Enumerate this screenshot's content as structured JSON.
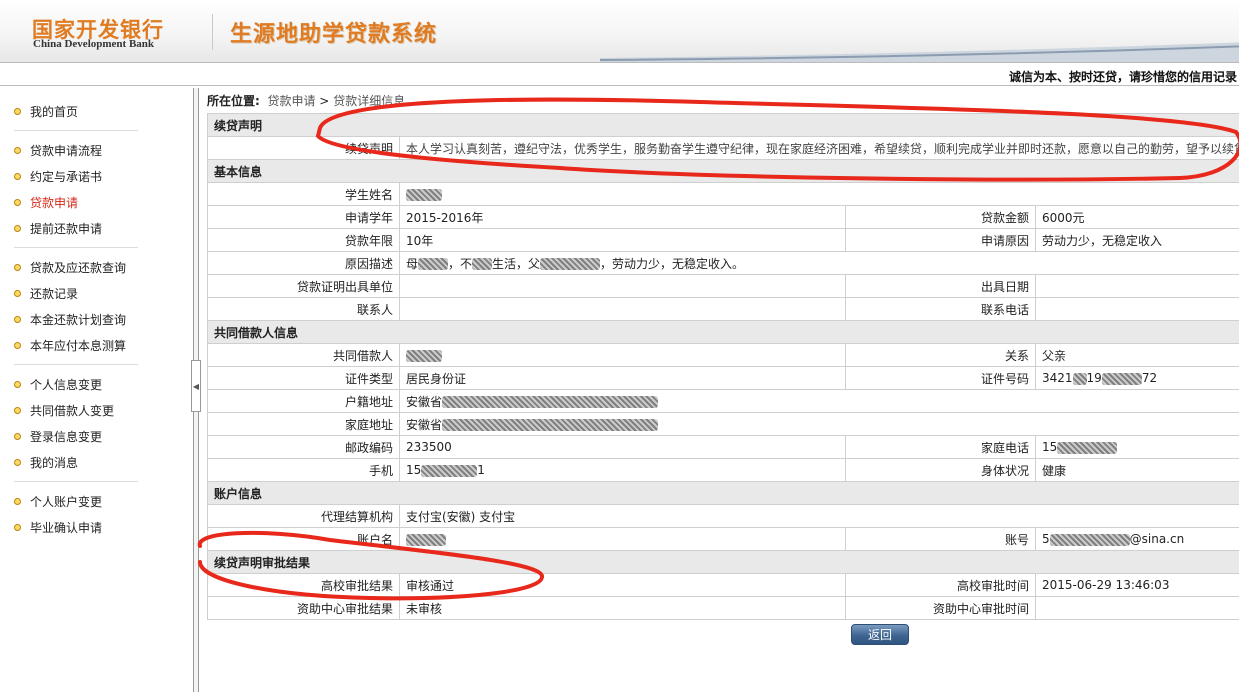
{
  "header": {
    "bank_cn": "国家开发银行",
    "bank_en": "China Development Bank",
    "system_title": "生源地助学贷款系统",
    "slogan": "诚信为本、按时还贷，请珍惜您的信用记录"
  },
  "sidebar": {
    "groups": [
      [
        {
          "label": "我的首页"
        }
      ],
      [
        {
          "label": "贷款申请流程"
        },
        {
          "label": "约定与承诺书"
        },
        {
          "label": "贷款申请",
          "active": true
        },
        {
          "label": "提前还款申请"
        }
      ],
      [
        {
          "label": "贷款及应还款查询"
        },
        {
          "label": "还款记录"
        },
        {
          "label": "本金还款计划查询"
        },
        {
          "label": "本年应付本息测算"
        }
      ],
      [
        {
          "label": "个人信息变更"
        },
        {
          "label": "共同借款人变更"
        },
        {
          "label": "登录信息变更"
        },
        {
          "label": "我的消息"
        }
      ],
      [
        {
          "label": "个人账户变更"
        },
        {
          "label": "毕业确认申请"
        }
      ]
    ]
  },
  "breadcrumb": {
    "label": "所在位置:",
    "path1": "贷款申请",
    "sep": ">",
    "path2": "贷款详细信息"
  },
  "sections": {
    "renewal": "续贷声明",
    "basic": "基本信息",
    "coborrower": "共同借款人信息",
    "account": "账户信息",
    "renewal_result": "续贷声明审批结果"
  },
  "renewal": {
    "declaration_label": "续贷声明",
    "declaration_text": "本人学习认真刻苦，遵纪守法，优秀学生，服务勤奋学生遵守纪律，现在家庭经济困难，希望续贷，顺利完成学业并即时还款，愿意以自己的勤劳，望予以续贷。"
  },
  "basic": {
    "student_name_label": "学生姓名",
    "student_name": "",
    "year_label": "申请学年",
    "year": "2015-2016年",
    "amount_label": "贷款金额",
    "amount": "6000元",
    "term_label": "贷款年限",
    "term": "10年",
    "reason_label": "申请原因",
    "reason": "劳动力少，无稳定收入",
    "reason_desc_label": "原因描述",
    "reason_desc_a": "母",
    "reason_desc_b": "，不",
    "reason_desc_c": "生活，父",
    "reason_desc_d": "，劳动力少，无稳定收入。",
    "cert_unit_label": "贷款证明出具单位",
    "cert_unit": "",
    "cert_date_label": "出具日期",
    "cert_date": "",
    "contact_label": "联系人",
    "contact": "",
    "contact_phone_label": "联系电话",
    "contact_phone": ""
  },
  "coborrower": {
    "name_label": "共同借款人",
    "relation_label": "关系",
    "relation": "父亲",
    "id_type_label": "证件类型",
    "id_type": "居民身份证",
    "id_no_label": "证件号码",
    "id_no_a": "3421",
    "id_no_b": "19",
    "id_no_c": "72",
    "hukou_label": "户籍地址",
    "hukou_prefix": "安徽省",
    "home_label": "家庭地址",
    "home_prefix": "安徽省",
    "postcode_label": "邮政编码",
    "postcode": "233500",
    "home_phone_label": "家庭电话",
    "home_phone_prefix": "15",
    "mobile_label": "手机",
    "mobile_a": "15",
    "mobile_b": "1",
    "health_label": "身体状况",
    "health": "健康"
  },
  "account": {
    "agency_label": "代理结算机构",
    "agency": "支付宝(安徽) 支付宝",
    "holder_label": "账户名",
    "account_no_label": "账号",
    "account_no_a": "5",
    "account_no_b": "@sina.cn"
  },
  "renewal_result": {
    "school_result_label": "高校审批结果",
    "school_result": "审核通过",
    "school_time_label": "高校审批时间",
    "school_time": "2015-06-29 13:46:03",
    "center_result_label": "资助中心审批结果",
    "center_result": "未审核",
    "center_time_label": "资助中心审批时间",
    "center_time": ""
  },
  "actions": {
    "return_label": "返回"
  },
  "colors": {
    "brand_orange": "#e07b22",
    "active_link": "#d62a1a",
    "annotation_red": "#e8281a",
    "button_blue": "#3f6692"
  }
}
